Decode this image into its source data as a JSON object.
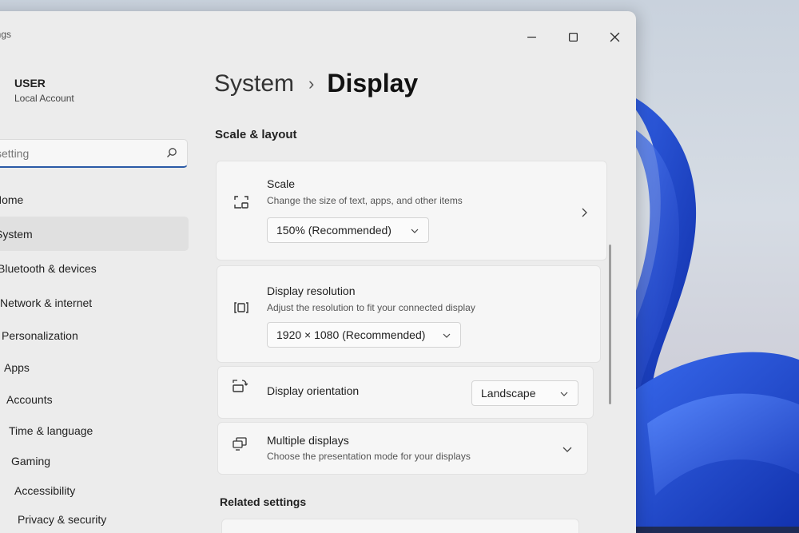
{
  "window": {
    "title": "ings",
    "controls": {
      "minimize": "minimize-icon",
      "maximize": "maximize-icon",
      "close": "close-icon"
    }
  },
  "user": {
    "name": "USER",
    "type": "Local Account"
  },
  "search": {
    "placeholder": "setting"
  },
  "sidebar": {
    "items": [
      {
        "label": "Home"
      },
      {
        "label": "System",
        "active": true
      },
      {
        "label": "Bluetooth & devices"
      },
      {
        "label": "Network & internet"
      },
      {
        "label": "Personalization"
      },
      {
        "label": "Apps"
      },
      {
        "label": "Accounts"
      },
      {
        "label": "Time & language"
      },
      {
        "label": "Gaming"
      },
      {
        "label": "Accessibility"
      },
      {
        "label": "Privacy & security"
      }
    ]
  },
  "breadcrumb": {
    "parent": "System",
    "separator": "›",
    "current": "Display"
  },
  "section": {
    "title": "Scale & layout"
  },
  "cards": {
    "scale": {
      "title": "Scale",
      "subtitle": "Change the size of text, apps, and other items",
      "value": "150% (Recommended)",
      "icon": "scale-icon"
    },
    "resolution": {
      "title": "Display resolution",
      "subtitle": "Adjust the resolution to fit your connected display",
      "value": "1920 × 1080 (Recommended)",
      "icon": "resolution-icon"
    },
    "orientation": {
      "title": "Display orientation",
      "value": "Landscape",
      "icon": "orientation-icon"
    },
    "multiple": {
      "title": "Multiple displays",
      "subtitle": "Choose the presentation mode for your displays",
      "icon": "multiple-displays-icon"
    }
  },
  "related": {
    "title": "Related settings"
  },
  "colors": {
    "accent": "#2a5aa6",
    "wallpaper_blue": "#1f4fd6"
  }
}
